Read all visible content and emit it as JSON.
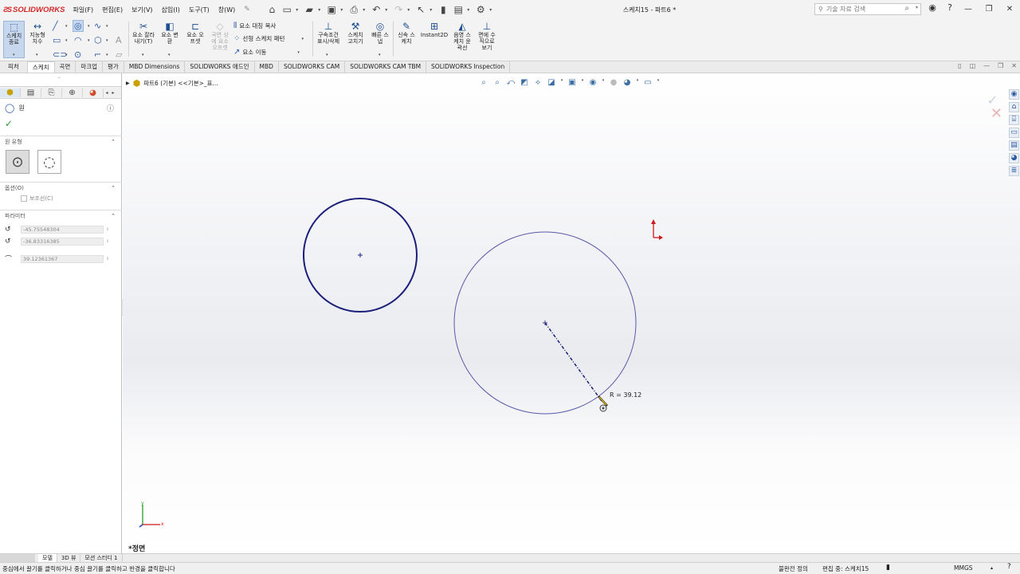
{
  "app": {
    "logo": "SOLIDWORKS",
    "logo_mark": "ƧS",
    "document_title": "스케치15 - 파트6 *"
  },
  "menus": [
    "파일(F)",
    "편집(E)",
    "보기(V)",
    "삽입(I)",
    "도구(T)",
    "창(W)"
  ],
  "search": {
    "placeholder": "기술 자료 검색"
  },
  "ribbon": {
    "exit_sketch": "스케치 종료",
    "smart_dim": "지능형 치수",
    "trim": "요소 잘라내기(T)",
    "convert": "요소 변환",
    "offset": "요소 오프셋",
    "surface_offset": "곡면 상에 요소 오프셋",
    "mirror": "요소 대칭 복사",
    "linear_pattern": "선형 스케치 패턴",
    "move": "요소 이동",
    "relations": "구속조건 표시/삭제",
    "repair": "스케치 고치기",
    "quick_snaps": "빠른 스냅",
    "rapid_sketch": "신속 스케치",
    "instant2d": "Instant2D",
    "shaded": "음영 스케치 윤곽선",
    "normal_to": "면에 수직으로 보기"
  },
  "tabs": [
    "피처",
    "스케치",
    "곡면",
    "마크업",
    "평가",
    "MBD Dimensions",
    "SOLIDWORKS 애드인",
    "MBD",
    "SOLIDWORKS CAM",
    "SOLIDWORKS CAM TBM",
    "SOLIDWORKS Inspection"
  ],
  "active_tab": "스케치",
  "panel": {
    "title": "원",
    "sections": {
      "circle_type": "원 유형",
      "options": "옵션(O)",
      "parameters": "파라미터"
    },
    "construction_label": "보조선(C)",
    "params": {
      "cx": "-45.75548304",
      "cy": "-36.83316385",
      "radius": "39.12361367"
    }
  },
  "viewport": {
    "tree_path": "파트6 (기본) <<기본>_표...",
    "view_name": "*정면",
    "radius_label": "R = 39.12",
    "axis_x": "x",
    "axis_y": "y"
  },
  "bottom_tabs": [
    "모델",
    "3D 뷰",
    "모션 스터디 1"
  ],
  "status": {
    "message": "중심에서 끌기를 클릭하거나 중심 끌기를 클릭하고 반경을 클릭합니다",
    "definition": "불완전 정의",
    "editing": "편집 중: 스케치15",
    "units": "MMGS"
  }
}
